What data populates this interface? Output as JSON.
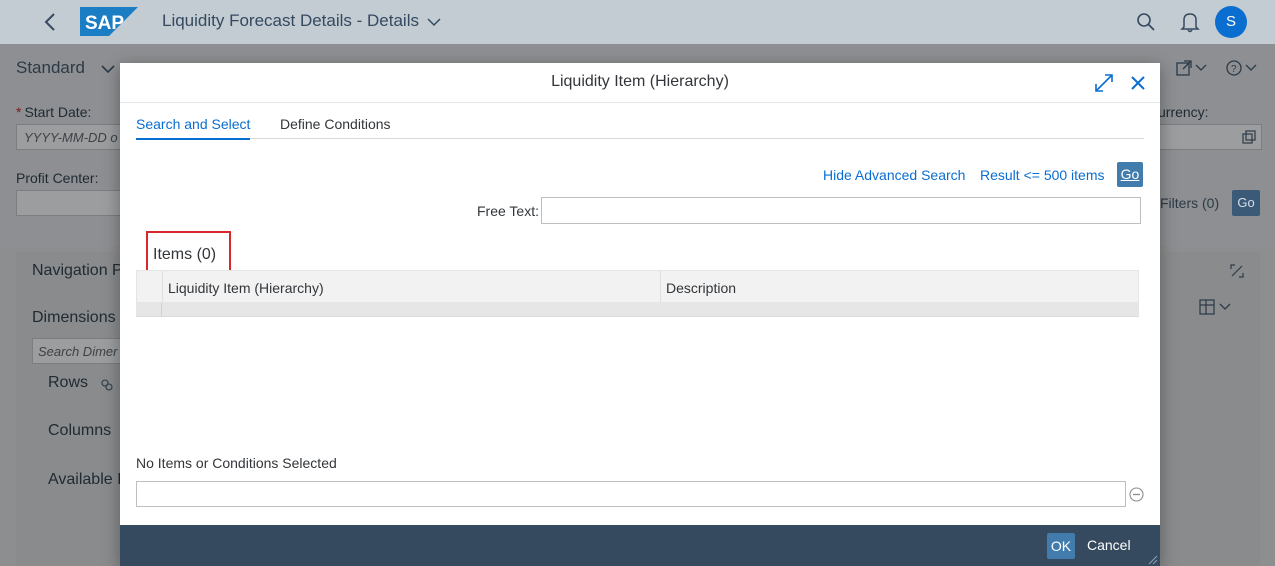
{
  "shell": {
    "logo_text": "SAP",
    "title": "Liquidity Forecast Details - Details",
    "avatar_initial": "S"
  },
  "background": {
    "variant_label": "Standard",
    "start_date_label": "Start Date:",
    "start_date_placeholder": "YYYY-MM-DD o",
    "profit_center_label": "Profit Center:",
    "currency_label": "urrency:",
    "filters_label": "Filters (0)",
    "go_label": "Go",
    "nav_panel_title": "Navigation P",
    "dimensions_label": "Dimensions",
    "search_dimensions_placeholder": "Search Dimer",
    "rows_label": "Rows",
    "columns_label": "Columns",
    "available_label": "Available I"
  },
  "dialog": {
    "title": "Liquidity Item (Hierarchy)",
    "tabs": [
      {
        "label": "Search and Select",
        "active": true
      },
      {
        "label": "Define Conditions",
        "active": false
      }
    ],
    "hide_advanced_search": "Hide Advanced Search",
    "result_limit": "Result <= 500 items",
    "go_label": "Go",
    "free_text_label": "Free Text:",
    "free_text_value": "",
    "items_title": "Items (0)",
    "table": {
      "columns": [
        "Liquidity Item (Hierarchy)",
        "Description"
      ],
      "rows": []
    },
    "selection_label": "No Items or Conditions Selected",
    "ok_label": "OK",
    "cancel_label": "Cancel"
  },
  "colors": {
    "accent": "#0a6ed1",
    "emphasized_button": "#427cac",
    "footer": "#354a5f",
    "highlight_box": "#d9272e"
  }
}
